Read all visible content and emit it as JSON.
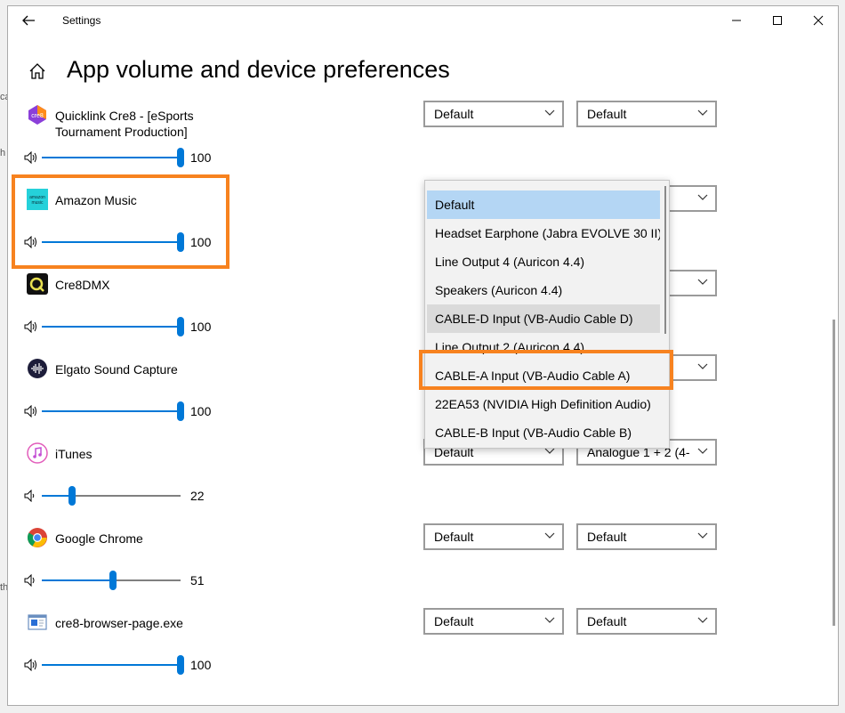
{
  "background_text": {
    "line1": "ca",
    "line2": "h",
    "line3": "th"
  },
  "window": {
    "title": "Settings"
  },
  "page": {
    "title": "App volume and device preferences"
  },
  "apps": [
    {
      "name": "Quicklink Cre8  - [eSports Tournament Production]",
      "volume": "100",
      "level": 100,
      "icon": "cre8-app-icon",
      "output": "Default",
      "input": "Default"
    },
    {
      "name": "Amazon Music",
      "volume": "100",
      "level": 100,
      "icon": "amazon-music-icon",
      "output": "",
      "input": ""
    },
    {
      "name": "Cre8DMX",
      "volume": "100",
      "level": 100,
      "icon": "cre8dmx-icon",
      "output": "",
      "input": ""
    },
    {
      "name": "Elgato Sound Capture",
      "volume": "100",
      "level": 100,
      "icon": "elgato-icon",
      "output": "",
      "input": ""
    },
    {
      "name": "iTunes",
      "volume": "22",
      "level": 22,
      "icon": "itunes-icon",
      "output": "Default",
      "input": "Analogue 1 + 2 (4-"
    },
    {
      "name": "Google Chrome",
      "volume": "51",
      "level": 51,
      "icon": "chrome-icon",
      "output": "Default",
      "input": "Default"
    },
    {
      "name": "cre8-browser-page.exe",
      "volume": "100",
      "level": 100,
      "icon": "browser-page-icon",
      "output": "Default",
      "input": "Default"
    }
  ],
  "output_dropdown_popup": {
    "options": [
      "Default",
      "Headset Earphone (Jabra EVOLVE 30 II)",
      "Line Output 4 (Auricon 4.4)",
      "Speakers (Auricon 4.4)",
      "CABLE-D Input (VB-Audio Cable D)",
      "Line Output 2 (Auricon 4.4)",
      "CABLE-A Input (VB-Audio Cable A)",
      "22EA53 (NVIDIA High Definition Audio)",
      "CABLE-B Input (VB-Audio Cable B)"
    ],
    "selected": "Default",
    "hovered": "CABLE-D Input (VB-Audio Cable D)",
    "highlighted": "CABLE-A Input (VB-Audio Cable A)"
  },
  "colors": {
    "accent": "#0078d7",
    "highlight": "#f7821f",
    "selected_option": "#b4d6f4"
  }
}
